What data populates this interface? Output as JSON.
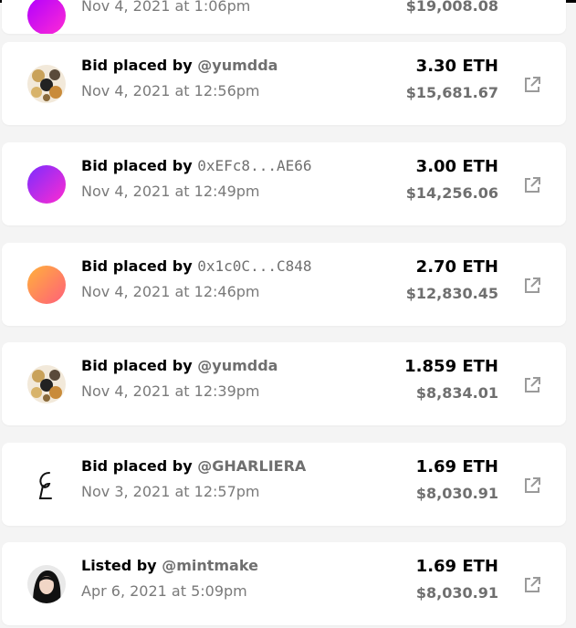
{
  "colors": {
    "background": "#f4f4f4",
    "card": "#ffffff",
    "primary_text": "#000000",
    "muted_text": "#6f6f6f",
    "icon": "#9a9a9a"
  },
  "top_partial": {
    "date": "Nov 4, 2021 at 1:06pm",
    "usd": "$19,008.08",
    "avatar_colors": [
      "#b000ff",
      "#ff2ad4"
    ]
  },
  "activities": [
    {
      "action": "Bid placed by",
      "who": "@yumdda",
      "who_mono": false,
      "date": "Nov 4, 2021 at 12:56pm",
      "eth": "3.30 ETH",
      "usd": "$15,681.67",
      "avatar": "photo-collage"
    },
    {
      "action": "Bid placed by",
      "who": "0xEFc8...AE66",
      "who_mono": true,
      "date": "Nov 4, 2021 at 12:49pm",
      "eth": "3.00 ETH",
      "usd": "$14,256.06",
      "avatar": "gradient-purple-pink",
      "avatar_colors": [
        "#7b2cff",
        "#ff2bd0"
      ]
    },
    {
      "action": "Bid placed by",
      "who": "0x1c0C...C848",
      "who_mono": true,
      "date": "Nov 4, 2021 at 12:46pm",
      "eth": "2.70 ETH",
      "usd": "$12,830.45",
      "avatar": "gradient-orange-pink",
      "avatar_colors": [
        "#ffb13b",
        "#ff5f7a"
      ]
    },
    {
      "action": "Bid placed by",
      "who": "@yumdda",
      "who_mono": false,
      "date": "Nov 4, 2021 at 12:39pm",
      "eth": "1.859 ETH",
      "usd": "$8,834.01",
      "avatar": "photo-collage"
    },
    {
      "action": "Bid placed by",
      "who": "@GHARLIERA",
      "who_mono": false,
      "date": "Nov 3, 2021 at 12:57pm",
      "eth": "1.69 ETH",
      "usd": "$8,030.91",
      "avatar": "calligraphy-logo"
    },
    {
      "action": "Listed by",
      "who": "@mintmake",
      "who_mono": false,
      "date": "Apr 6, 2021 at 5:09pm",
      "eth": "1.69 ETH",
      "usd": "$8,030.91",
      "avatar": "portrait"
    }
  ],
  "icons": {
    "external_link": "external-link-icon"
  }
}
